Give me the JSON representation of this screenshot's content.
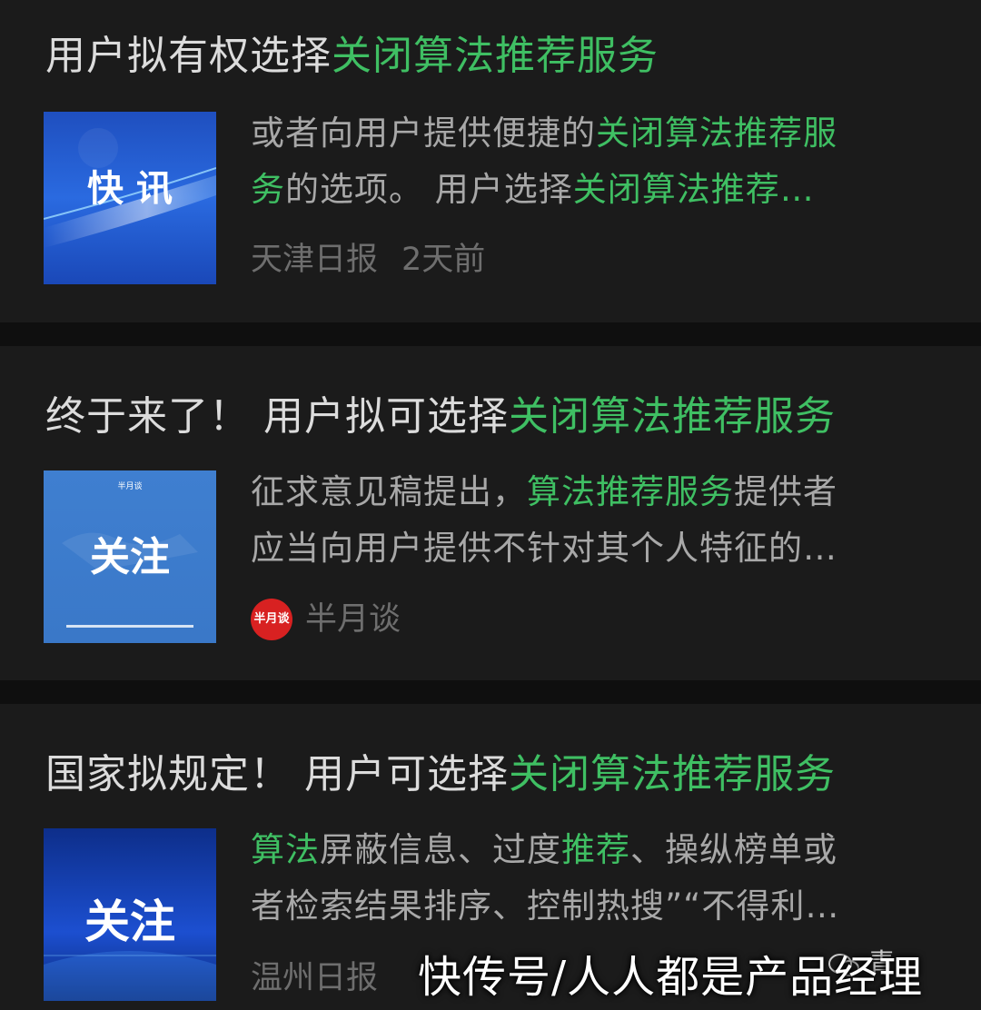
{
  "colors": {
    "highlight": "#3fbf63",
    "title": "#dcdcdc",
    "snippet": "#a8a8a8",
    "meta": "#6e6e6e",
    "card_bg": "#1b1b1b"
  },
  "articles": [
    {
      "title_plain": "用户拟有权选择",
      "title_highlight": "关闭算法推荐服务",
      "thumb_text": "快 讯",
      "line1_plain": "或者向用户提供便捷的",
      "line1_hl": "关闭算法推荐服",
      "line2_hl1": "务",
      "line2_plain": "的选项。 用户选择",
      "line2_hl2": "关闭算法推荐…",
      "source": "天津日报",
      "time": "2天前"
    },
    {
      "title_plain": "终于来了！ 用户拟可选择",
      "title_highlight": "关闭算法推荐服务",
      "thumb_small": "半月谈",
      "thumb_text": "关注",
      "line1_plain1": "征求意见稿提出，",
      "line1_hl": "算法推荐服务",
      "line1_plain2": "提供者",
      "line2_plain": "应当向用户提供不针对其个人特征的…",
      "source_logo": "半月谈",
      "source": "半月谈"
    },
    {
      "title_plain": "国家拟规定！ 用户可选择",
      "title_highlight": "关闭算法推荐服务",
      "thumb_text": "关注",
      "line1_hl1": "算法",
      "line1_plain1": "屏蔽信息、过度",
      "line1_hl2": "推荐",
      "line1_plain2": "、操纵榜单或",
      "line2_plain": "者检索结果排序、控制热搜”“不得利…",
      "source": "温州日报"
    }
  ],
  "watermark": {
    "text": "快传号/人人都是产品经理",
    "icon": "wechat-icon",
    "icon_text": "青"
  }
}
